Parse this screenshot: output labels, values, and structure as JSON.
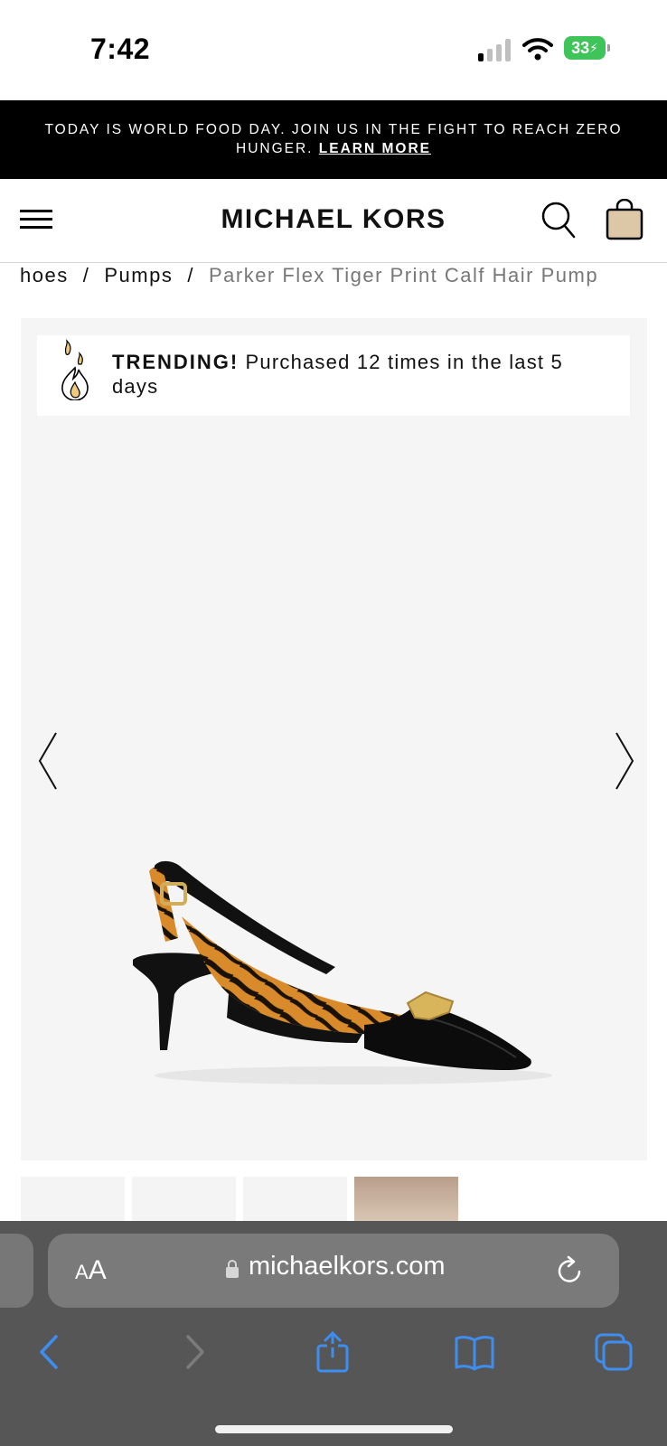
{
  "status_bar": {
    "time": "7:42",
    "battery_level": "33",
    "battery_charging": true,
    "signal_bars_filled": 1,
    "signal_bars_total": 4
  },
  "announcement": {
    "text": "TODAY IS WORLD FOOD DAY. JOIN US IN THE FIGHT TO REACH ZERO HUNGER.",
    "link_label": "LEARN MORE"
  },
  "header": {
    "brand": "MICHAEL KORS",
    "icons": [
      "menu-icon",
      "search-icon",
      "shopping-bag-icon"
    ]
  },
  "breadcrumb": {
    "items": [
      "hoes",
      "Pumps",
      "Parker Flex Tiger Print Calf Hair Pump"
    ],
    "separator": "/"
  },
  "gallery": {
    "trending_label": "TRENDING!",
    "trending_text": "Purchased 12 times in the last 5 days",
    "product_image": "tiger-print-slingback-pump",
    "thumbnail_count": 4
  },
  "browser": {
    "aa_small": "A",
    "aa_large": "A",
    "url": "michaelkors.com",
    "accent_color": "#3d8ef0",
    "toolbar_icons": [
      "back-icon",
      "forward-icon",
      "share-icon",
      "bookmarks-icon",
      "tabs-icon"
    ]
  }
}
